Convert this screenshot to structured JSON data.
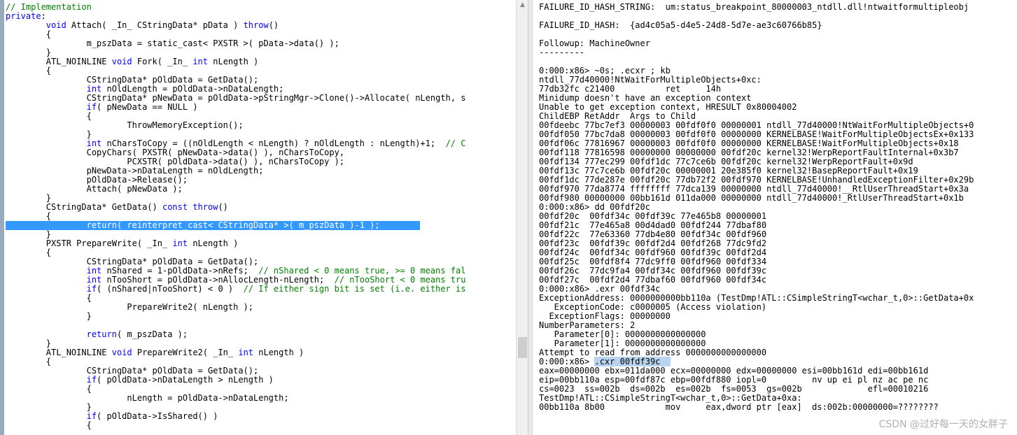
{
  "source": {
    "lines": [
      "// Implementation",
      "private:",
      "\tvoid Attach( _In_ CStringData* pData ) throw()",
      "\t{",
      "\t\tm_pszData = static_cast< PXSTR >( pData->data() );",
      "\t}",
      "\tATL_NOINLINE void Fork( _In_ int nLength )",
      "\t{",
      "\t\tCStringData* pOldData = GetData();",
      "\t\tint nOldLength = pOldData->nDataLength;",
      "\t\tCStringData* pNewData = pOldData->pStringMgr->Clone()->Allocate( nLength, s",
      "\t\tif( pNewData == NULL )",
      "\t\t{",
      "\t\t\tThrowMemoryException();",
      "\t\t}",
      "\t\tint nCharsToCopy = ((nOldLength < nLength) ? nOldLength : nLength)+1;  // C",
      "\t\tCopyChars( PXSTR( pNewData->data() ), nCharsToCopy,",
      "\t\t\tPCXSTR( pOldData->data() ), nCharsToCopy );",
      "\t\tpNewData->nDataLength = nOldLength;",
      "\t\tpOldData->Release();",
      "\t\tAttach( pNewData );",
      "\t}",
      "\tCStringData* GetData() const throw()",
      "\t{",
      "\t\treturn( reinterpret_cast< CStringData* >( m_pszData )-1 );",
      "\t}",
      "\tPXSTR PrepareWrite( _In_ int nLength )",
      "\t{",
      "\t\tCStringData* pOldData = GetData();",
      "\t\tint nShared = 1-pOldData->nRefs;  // nShared < 0 means true, >= 0 means fal",
      "\t\tint nTooShort = pOldData->nAllocLength-nLength;  // nTooShort < 0 means tru",
      "\t\tif( (nShared|nTooShort) < 0 )  // If either sign bit is set (i.e. either is",
      "\t\t{",
      "\t\t\tPrepareWrite2( nLength );",
      "\t\t}",
      "",
      "\t\treturn( m_pszData );",
      "\t}",
      "\tATL_NOINLINE void PrepareWrite2( _In_ int nLength )",
      "\t{",
      "\t\tCStringData* pOldData = GetData();",
      "\t\tif( pOldData->nDataLength > nLength )",
      "\t\t{",
      "\t\t\tnLength = pOldData->nDataLength;",
      "\t\t}",
      "\t\tif( pOldData->IsShared() )",
      "\t\t{"
    ],
    "highlighted_line": 24
  },
  "debugger": {
    "lines": [
      "FAILURE_ID_HASH_STRING:  um:status_breakpoint_80000003_ntdll.dll!ntwaitformultipleobj",
      "",
      "FAILURE_ID_HASH:  {ad4c05a5-d4e5-24d8-5d7e-ae3c60766b85}",
      "",
      "Followup: MachineOwner",
      "---------",
      "",
      "0:000:x86> ~0s; .ecxr ; kb",
      "ntdll_77d40000!NtWaitForMultipleObjects+0xc:",
      "77db32fc c21400          ret     14h",
      "Minidump doesn't have an exception context",
      "Unable to get exception context, HRESULT 0x80004002",
      "ChildEBP RetAddr  Args to Child",
      "00fdeebc 77bc7ef3 00000003 00fdf0f0 00000001 ntdll_77d40000!NtWaitForMultipleObjects+0",
      "00fdf050 77bc7da8 00000003 00fdf0f0 00000000 KERNELBASE!WaitForMultipleObjectsEx+0x133",
      "00fdf06c 77816967 00000003 00fdf0f0 00000000 KERNELBASE!WaitForMultipleObjects+0x18",
      "00fdf118 77816598 00000000 00000000 00fdf20c kernel32!WerpReportFaultInternal+0x3b7",
      "00fdf134 777ec299 00fdf1dc 77c7ce6b 00fdf20c kernel32!WerpReportFault+0x9d",
      "00fdf13c 77c7ce6b 00fdf20c 00000001 20e385f0 kernel32!BasepReportFault+0x19",
      "00fdf1dc 77de287e 00fdf20c 77db72f2 00fdf970 KERNELBASE!UnhandledExceptionFilter+0x29b",
      "00fdf970 77da8774 ffffffff 77dca139 00000000 ntdll_77d40000!__RtlUserThreadStart+0x3a",
      "00fdf980 00000000 00bb161d 011da000 00000000 ntdll_77d40000!_RtlUserThreadStart+0x1b",
      "0:000:x86> dd 00fdf20c",
      "00fdf20c  00fdf34c 00fdf39c 77e465b8 00000001",
      "00fdf21c  77e465a8 00d4dad0 00fdf244 77dbaf80",
      "00fdf22c  77e63360 77db4e80 00fdf34c 00fdf960",
      "00fdf23c  00fdf39c 00fdf2d4 00fdf268 77dc9fd2",
      "00fdf24c  00fdf34c 00fdf960 00fdf39c 00fdf2d4",
      "00fdf25c  00fdf8f4 77dc9ff0 00fdf960 00fdf334",
      "00fdf26c  77dc9fa4 00fdf34c 00fdf960 00fdf39c",
      "00fdf27c  00fdf2d4 77dbaf60 00fdf960 00fdf34c",
      "0:000:x86> .exr 00fdf34c",
      "ExceptionAddress: 0000000000bb110a (TestDmp!ATL::CSimpleStringT<wchar_t,0>::GetData+0x",
      "   ExceptionCode: c0000005 (Access violation)",
      "  ExceptionFlags: 00000000",
      "NumberParameters: 2",
      "   Parameter[0]: 0000000000000000",
      "   Parameter[1]: 0000000000000000",
      "Attempt to read from address 0000000000000000",
      "0:000:x86> ",
      "eax=00000000 ebx=011da000 ecx=00000000 edx=00000000 esi=00bb161d edi=00bb161d",
      "eip=00bb110a esp=00fdf87c ebp=00fdf880 iopl=0         nv up ei pl nz ac pe nc",
      "cs=0023  ss=002b  ds=002b  es=002b  fs=0053  gs=002b             efl=00010216",
      "TestDmp!ATL::CSimpleStringT<wchar_t,0>::GetData+0xa:",
      "00bb110a 8b00            mov     eax,dword ptr [eax]  ds:002b:00000000=????????"
    ],
    "selected_command": ".cxr 00fdf39c",
    "selected_line": 39
  },
  "watermark": "CSDN @过好每一天的女胖子",
  "icons": {
    "scroll_up": "scroll-up-arrow",
    "scroll_down": "scroll-down-arrow"
  }
}
